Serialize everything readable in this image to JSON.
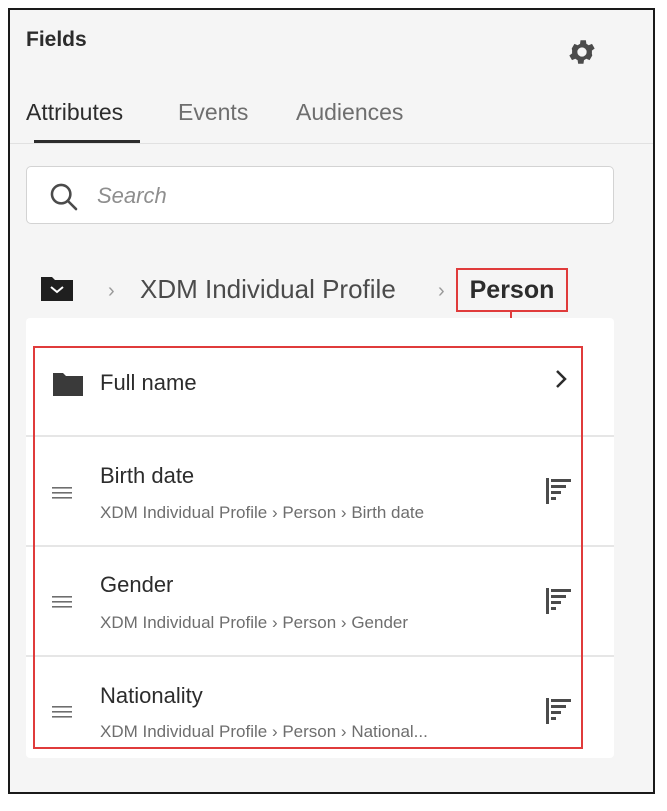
{
  "panel": {
    "title": "Fields"
  },
  "tabs": [
    {
      "label": "Attributes",
      "active": true
    },
    {
      "label": "Events",
      "active": false
    },
    {
      "label": "Audiences",
      "active": false
    }
  ],
  "search": {
    "placeholder": "Search",
    "value": ""
  },
  "breadcrumb": {
    "root_icon": "folder-icon",
    "link": "XDM Individual Profile",
    "current": "Person",
    "separator": "›"
  },
  "items": [
    {
      "type": "folder",
      "icon": "folder-icon",
      "title": "Full name",
      "action_icon": "chevron-right-icon"
    },
    {
      "type": "field",
      "icon": "drag-handle-icon",
      "title": "Birth date",
      "path": "XDM Individual Profile › Person › Birth date",
      "action_icon": "filter-icon"
    },
    {
      "type": "field",
      "icon": "drag-handle-icon",
      "title": "Gender",
      "path": "XDM Individual Profile › Person › Gender",
      "action_icon": "filter-icon"
    },
    {
      "type": "field",
      "icon": "drag-handle-icon",
      "title": "Nationality",
      "path": "XDM Individual Profile › Person › National...",
      "action_icon": "filter-icon"
    }
  ],
  "colors": {
    "highlight": "#e03b3b",
    "text": "#2c2c2c",
    "muted": "#6e6e6e",
    "panel_bg": "#f5f5f5"
  }
}
